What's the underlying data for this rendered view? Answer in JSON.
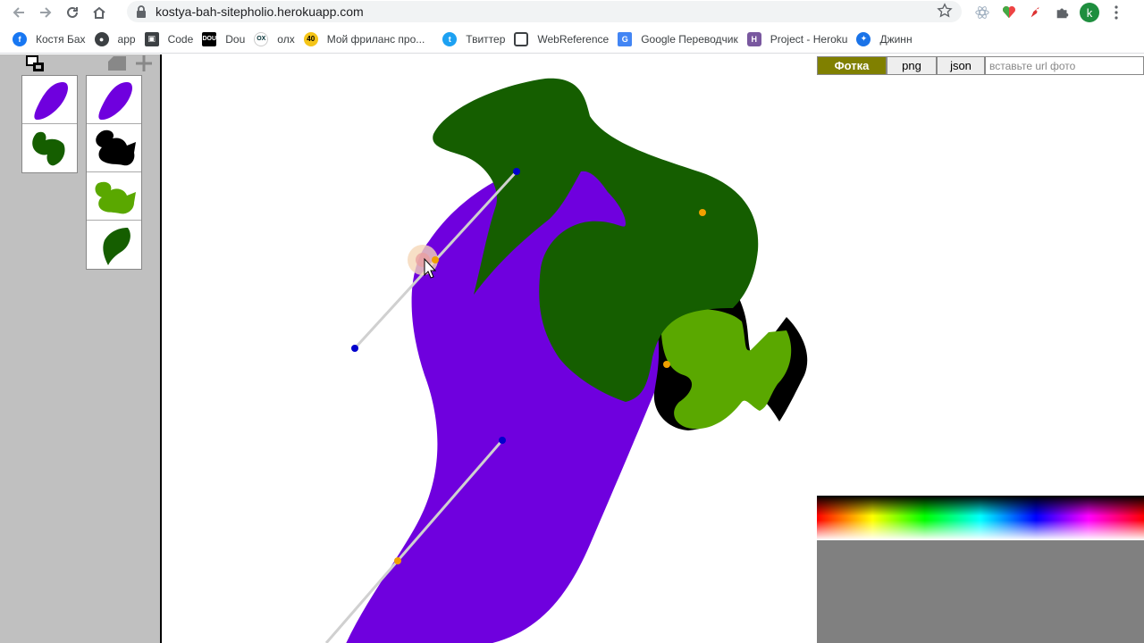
{
  "browser": {
    "url": "kostya-bah-sitepholio.herokuapp.com",
    "profile_initial": "k"
  },
  "bookmarks": [
    {
      "label": "Костя Бах",
      "icon": "facebook-icon",
      "color": "#1877f2"
    },
    {
      "label": "app",
      "icon": "globe-icon",
      "color": "#3c4043"
    },
    {
      "label": "Code",
      "icon": "cube-icon",
      "color": "#3c4043"
    },
    {
      "label": "Dou",
      "icon": "dou-icon",
      "color": "#000000"
    },
    {
      "label": "олх",
      "icon": "olx-icon",
      "color": "#ffffff"
    },
    {
      "label": "Мой фриланс про...",
      "icon": "freelance-icon",
      "color": "#f5c518"
    },
    {
      "label": "Твиттер",
      "icon": "twitter-icon",
      "color": "#1da1f2"
    },
    {
      "label": "WebReference",
      "icon": "chat-icon",
      "color": "#3c4043"
    },
    {
      "label": "Google Переводчик",
      "icon": "translate-icon",
      "color": "#4285f4"
    },
    {
      "label": "Project - Heroku",
      "icon": "heroku-icon",
      "color": "#79589f"
    },
    {
      "label": "Джинн",
      "icon": "genie-icon",
      "color": "#1a73e8"
    }
  ],
  "right_panel": {
    "photo_label": "Фотка",
    "png_label": "png",
    "json_label": "json",
    "url_placeholder": "вставьте url фото"
  },
  "colors": {
    "purple": "#6f00de",
    "dark_green": "#155e00",
    "light_green": "#5aa800",
    "black": "#000000",
    "handle_blue": "#0000cc",
    "handle_orange": "#f0a000"
  }
}
